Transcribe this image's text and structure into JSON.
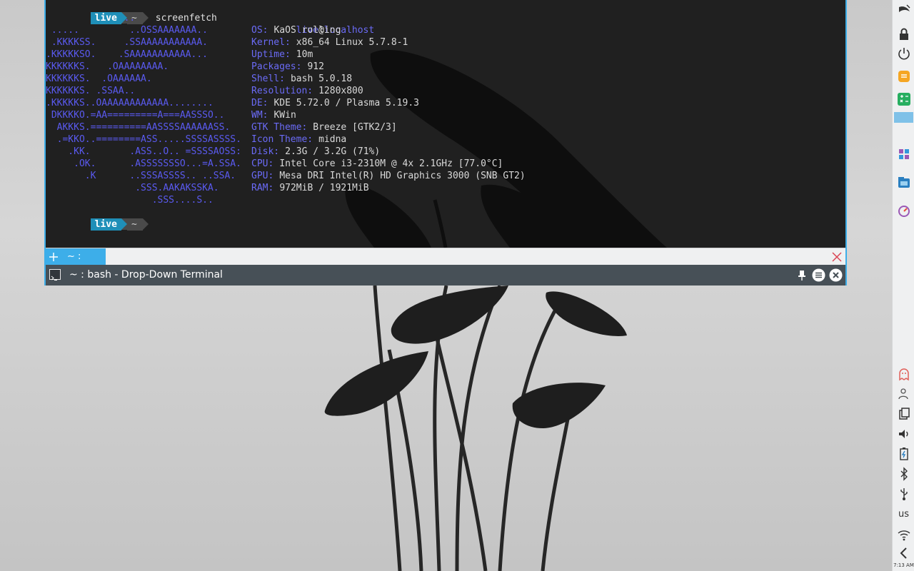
{
  "terminal": {
    "prompt": {
      "user": "live",
      "dir": "~"
    },
    "command": "screenfetch",
    "info_header": {
      "user": "live",
      "at": "@",
      "host": "localhost"
    },
    "logo_lines": [
      "              ..",
      " .....         ..OSSAAAAAAA..",
      " .KKKKSS.     .SSAAAAAAAAAAA.",
      ".KKKKKSO.    .SAAAAAAAAAAA...",
      "KKKKKKS.   .OAAAAAAAA.",
      "KKKKKKS.  .OAAAAAA.",
      "KKKKKKS. .SSAA..",
      ".KKKKKS..OAAAAAAAAAAAA........",
      " DKKKKO.=AA=========A===AASSSO..",
      "  AKKKS.==========AASSSSAAAAAASS.",
      "  .=KKO..========ASS.....SSSSASSSS.",
      "    .KK.       .ASS..O.. =SSSSAOSS:",
      "     .OK.      .ASSSSSSSO...=A.SSA.",
      "       .K      ..SSSASSSS.. ..SSA.",
      "                .SSS.AAKAKSSKA.",
      "                   .SSS....S.."
    ],
    "info": [
      {
        "key": "OS:",
        "value": "KaOS rolling"
      },
      {
        "key": "Kernel:",
        "value": "x86_64 Linux 5.7.8-1"
      },
      {
        "key": "Uptime:",
        "value": "10m"
      },
      {
        "key": "Packages:",
        "value": "912"
      },
      {
        "key": "Shell:",
        "value": "bash 5.0.18"
      },
      {
        "key": "Resolution:",
        "value": "1280x800"
      },
      {
        "key": "DE:",
        "value": "KDE 5.72.0 / Plasma 5.19.3"
      },
      {
        "key": "WM:",
        "value": "KWin"
      },
      {
        "key": "GTK Theme:",
        "value": "Breeze [GTK2/3]"
      },
      {
        "key": "Icon Theme:",
        "value": "midna"
      },
      {
        "key": "Disk:",
        "value": "2.3G / 3.2G (71%)"
      },
      {
        "key": "CPU:",
        "value": "Intel Core i3-2310M @ 4x 2.1GHz [77.0°C]"
      },
      {
        "key": "GPU:",
        "value": "Mesa DRI Intel(R) HD Graphics 3000 (SNB GT2)"
      },
      {
        "key": "RAM:",
        "value": "972MiB / 1921MiB"
      }
    ],
    "tab_label": "~ : bash",
    "window_title": "~ : bash - Drop-Down Terminal"
  },
  "panel": {
    "keyboard_layout": "us",
    "clock": "7:13 AM"
  },
  "colors": {
    "accent": "#3daee9",
    "logo_blue": "#5a5af0",
    "titlebar": "#475057"
  }
}
